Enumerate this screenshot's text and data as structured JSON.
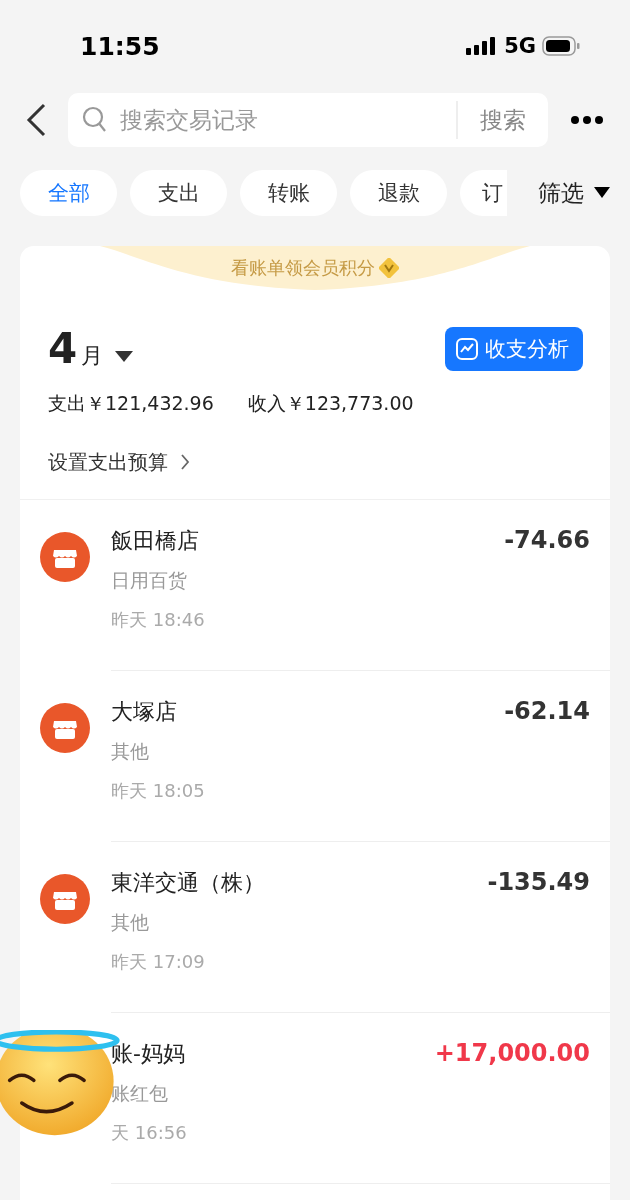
{
  "status_bar": {
    "time": "11:55",
    "network": "5G"
  },
  "search": {
    "placeholder": "搜索交易记录",
    "button": "搜索"
  },
  "chips": [
    {
      "label": "全部",
      "selected": true
    },
    {
      "label": "支出",
      "selected": false
    },
    {
      "label": "转账",
      "selected": false
    },
    {
      "label": "退款",
      "selected": false
    },
    {
      "label": "订",
      "selected": false
    }
  ],
  "filter": "筛选",
  "banner": "看账单领会员积分",
  "month": {
    "number": "4",
    "unit": "月"
  },
  "analysis_button": "收支分析",
  "totals": {
    "expense": "支出￥121,432.96",
    "income": "收入￥123,773.00"
  },
  "budget_link": "设置支出预算",
  "transactions": [
    {
      "title": "飯田橋店",
      "category": "日用百货",
      "time": "昨天 18:46",
      "amount": "-74.66",
      "kind": "expense"
    },
    {
      "title": "大塚店",
      "category": "其他",
      "time": "昨天 18:05",
      "amount": "-62.14",
      "kind": "expense"
    },
    {
      "title": "東洋交通（株）",
      "category": "其他",
      "time": "昨天 17:09",
      "amount": "-135.49",
      "kind": "expense"
    },
    {
      "title": "账-妈妈",
      "category": "账红包",
      "time": "天 16:56",
      "amount": "+17,000.00",
      "kind": "income"
    }
  ]
}
